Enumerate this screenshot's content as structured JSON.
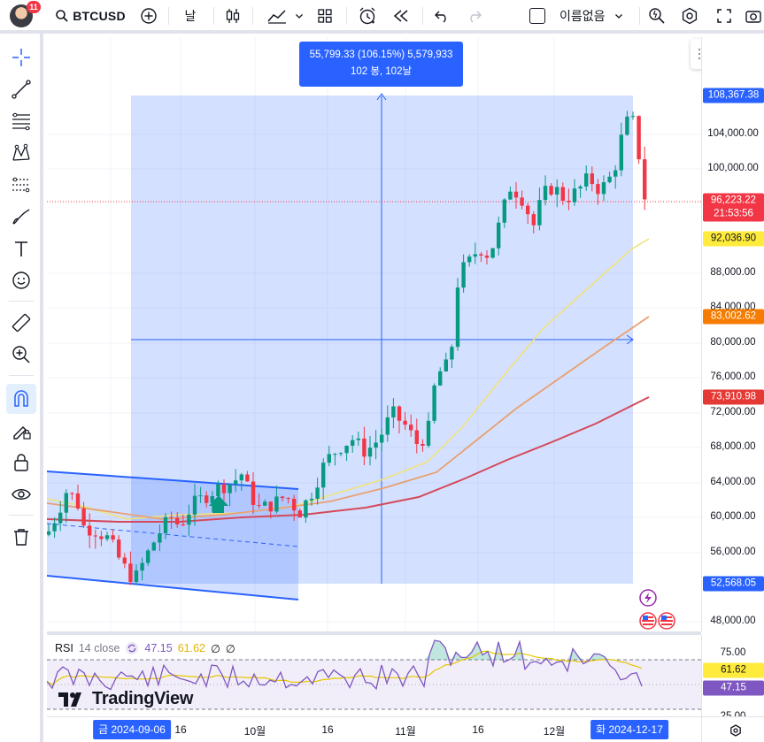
{
  "header": {
    "badge_count": "11",
    "symbol": "BTCUSD",
    "interval": "날",
    "layout_name": "이름없음"
  },
  "measure": {
    "line1": "55,799.33 (106.15%) 5,579,933",
    "line2": "102 봉, 102날"
  },
  "price_axis": {
    "ticks": [
      "104,000.00",
      "100,000.00",
      "88,000.00",
      "84,000.00",
      "80,000.00",
      "76,000.00",
      "72,000.00",
      "68,000.00",
      "64,000.00",
      "60,000.00",
      "56,000.00",
      "48,000.00"
    ],
    "labels": [
      {
        "text": "108,367.38",
        "color": "#2962ff"
      },
      {
        "text": "96,223.22",
        "color": "#f23645"
      },
      {
        "text": "21:53:56",
        "color": "#f23645"
      },
      {
        "text": "92,036.90",
        "color": "#ffeb3b"
      },
      {
        "text": "83,002.62",
        "color": "#f57c00"
      },
      {
        "text": "73,910.98",
        "color": "#e53935"
      },
      {
        "text": "52,568.05",
        "color": "#2962ff"
      }
    ]
  },
  "rsi": {
    "name": "RSI",
    "params": "14 close",
    "value1": "47.15",
    "value2": "61.62",
    "ticks": [
      "75.00",
      "25.00"
    ],
    "labels": [
      {
        "text": "61.62",
        "color": "#ffeb3b"
      },
      {
        "text": "47.15",
        "color": "#7e57c2"
      }
    ]
  },
  "time_axis": {
    "start_label": "금 2024-09-06",
    "end_label": "화 2024-12-17",
    "ticks": [
      "16",
      "10월",
      "16",
      "11월",
      "16",
      "12월"
    ]
  },
  "watermark": "TradingView",
  "colors": {
    "accent": "#2962ff",
    "up": "#089981",
    "down": "#f23645",
    "ma_fast": "#f0e27a",
    "ma_mid": "#e8a070",
    "ma_slow": "#d44a5a"
  },
  "toolbar_icons": [
    "add-symbol-icon",
    "candles-icon",
    "indicators-icon",
    "layout-icon",
    "alert-icon",
    "replay-icon",
    "undo-icon",
    "redo-icon",
    "quick-search-icon",
    "settings-icon",
    "fullscreen-icon",
    "snapshot-icon"
  ],
  "left_tools": [
    "crosshair-icon",
    "trendline-icon",
    "fib-icon",
    "pattern-icon",
    "prediction-icon",
    "brush-icon",
    "text-icon",
    "emoji-icon",
    "ruler-icon",
    "zoom-icon",
    "magnet-icon",
    "lock-drawing-icon",
    "lock-icon",
    "eye-icon",
    "trash-icon"
  ]
}
